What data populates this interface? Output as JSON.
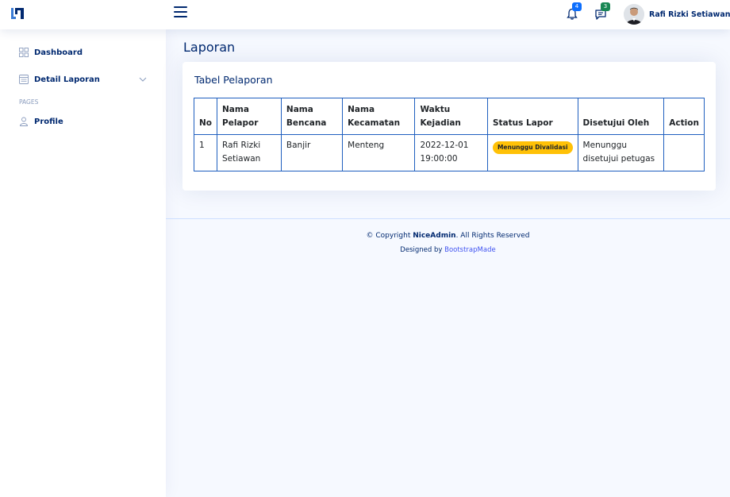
{
  "header": {
    "notif_count": "4",
    "msg_count": "3",
    "user_name": "Rafi Rizki Setiawan",
    "colors": {
      "notif_badge": "#0d6efd",
      "msg_badge": "#198754",
      "brand": "#012970"
    }
  },
  "sidebar": {
    "items": [
      {
        "label": "Dashboard",
        "icon": "grid-icon"
      },
      {
        "label": "Detail Laporan",
        "icon": "layout-text-icon"
      }
    ],
    "heading": "PAGES",
    "pages": [
      {
        "label": "Profile",
        "icon": "person-icon"
      }
    ]
  },
  "main": {
    "page_title": "Laporan",
    "card_title": "Tabel Pelaporan",
    "table": {
      "headers": [
        "No",
        "Nama Pelapor",
        "Nama Bencana",
        "Nama Kecamatan",
        "Waktu Kejadian",
        "Status Lapor",
        "Disetujui Oleh",
        "Action"
      ],
      "rows": [
        {
          "no": "1",
          "pelapor": "Rafi Rizki Setiawan",
          "bencana": "Banjir",
          "kecamatan": "Menteng",
          "waktu": "2022-12-01 19:00:00",
          "status": "Menunggu Divalidasi",
          "disetujui": "Menunggu disetujui petugas",
          "action": ""
        }
      ]
    }
  },
  "footer": {
    "copyright_prefix": "© Copyright ",
    "brand": "NiceAdmin",
    "copyright_suffix": ". All Rights Reserved",
    "designed_by": "Designed by ",
    "designer_link": "BootstrapMade"
  }
}
